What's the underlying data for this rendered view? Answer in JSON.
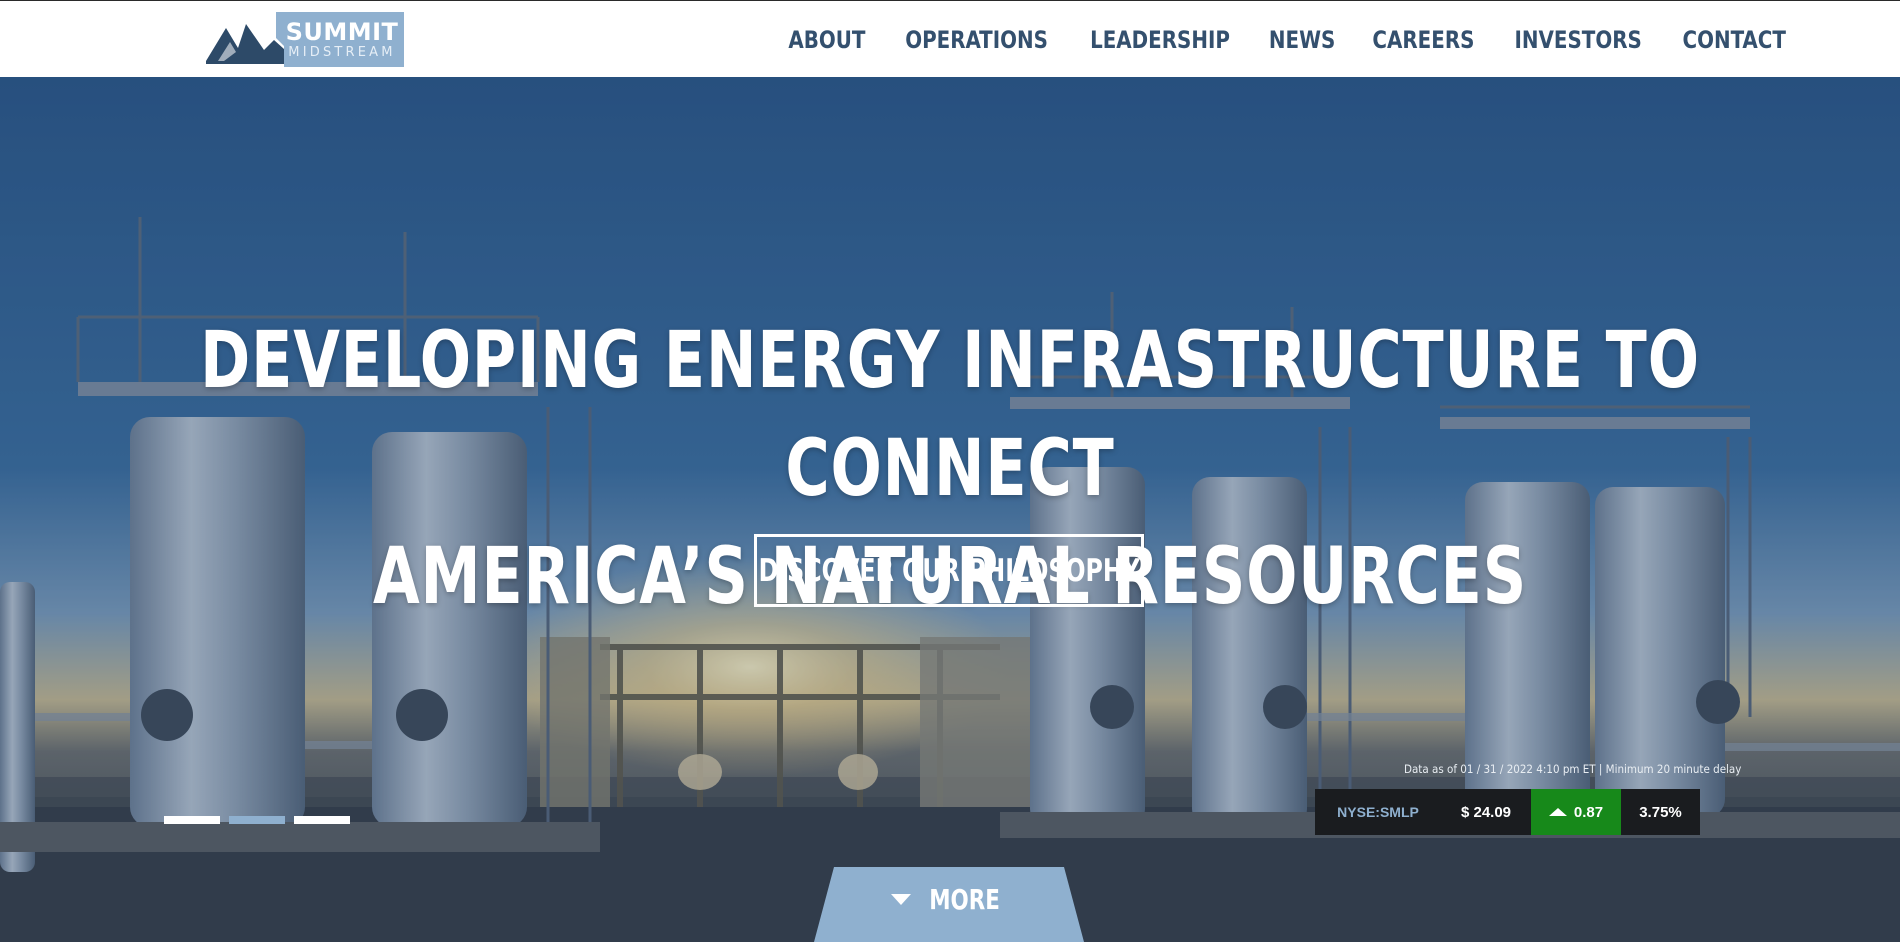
{
  "header": {
    "logo": {
      "name": "SUMMIT",
      "sub": "MIDSTREAM"
    },
    "nav": [
      "ABOUT",
      "OPERATIONS",
      "LEADERSHIP",
      "NEWS",
      "CAREERS",
      "INVESTORS",
      "CONTACT"
    ]
  },
  "hero": {
    "headline_line1": "DEVELOPING ENERGY INFRASTRUCTURE TO CONNECT",
    "headline_line2": "AMERICA’S NATURAL RESOURCES",
    "cta_label": "DISCOVER OUR PHILOSOPHY",
    "slides": {
      "count": 3,
      "active_index": 1
    }
  },
  "stock": {
    "note": "Data as of 01 / 31 / 2022 4:10 pm ET | Minimum 20 minute delay",
    "symbol": "NYSE:SMLP",
    "price": "$ 24.09",
    "change": "0.87",
    "change_direction": "up",
    "change_color": "#17891a",
    "percent": "3.75%"
  },
  "more": {
    "label": "MORE",
    "icon": "caret-down-icon"
  },
  "colors": {
    "nav_text": "#34506e",
    "logo_box": "#8fb0cf",
    "accent": "#8fb0cf",
    "sky": "#2b5786"
  }
}
